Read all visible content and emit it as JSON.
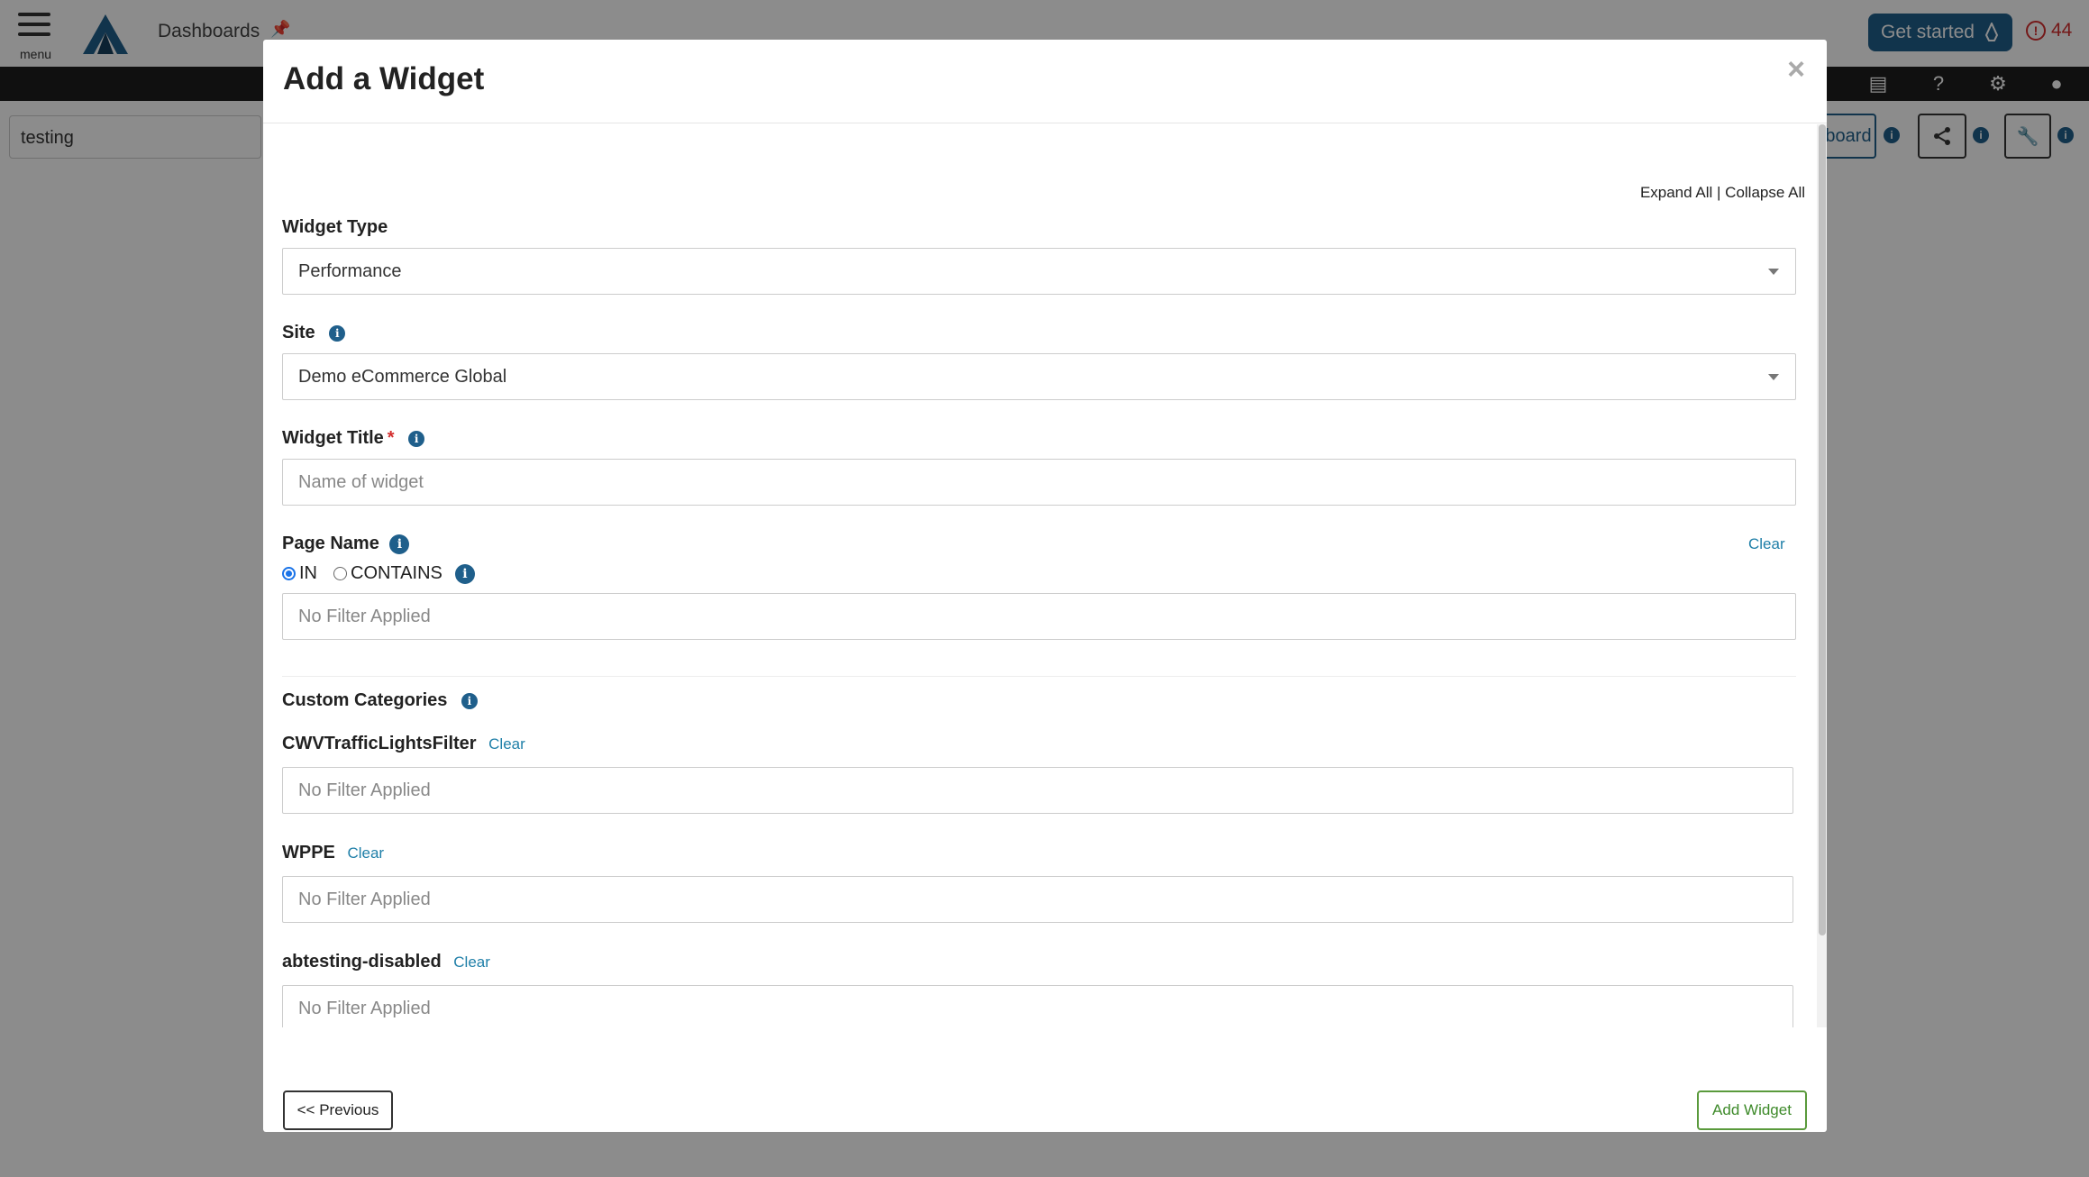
{
  "topbar": {
    "menu_label": "menu",
    "breadcrumb": "Dashboards",
    "get_started": "Get started",
    "alert_count": "44"
  },
  "subbar": {
    "dashboard_name": "testing",
    "board_button": "board"
  },
  "modal": {
    "title": "Add a Widget",
    "close": "×",
    "expand_all": "Expand All",
    "separator": "|",
    "collapse_all": "Collapse All",
    "widget_type": {
      "label": "Widget Type",
      "value": "Performance"
    },
    "site": {
      "label": "Site",
      "value": "Demo eCommerce Global"
    },
    "widget_title": {
      "label": "Widget Title",
      "required_mark": "*",
      "placeholder": "Name of widget"
    },
    "page_name": {
      "label": "Page Name",
      "clear": "Clear",
      "radio_in": "IN",
      "radio_contains": "CONTAINS",
      "selected": "IN",
      "placeholder": "No Filter Applied"
    },
    "custom_categories": {
      "label": "Custom Categories",
      "items": [
        {
          "name": "CWVTrafficLightsFilter",
          "clear": "Clear",
          "placeholder": "No Filter Applied"
        },
        {
          "name": "WPPE",
          "clear": "Clear",
          "placeholder": "No Filter Applied"
        },
        {
          "name": "abtesting-disabled",
          "clear": "Clear",
          "placeholder": "No Filter Applied"
        }
      ]
    },
    "footer": {
      "previous": "<< Previous",
      "add_widget": "Add Widget"
    }
  },
  "colors": {
    "accent": "#1f5f8b",
    "link": "#1f7fa8",
    "success": "#3e8a2a",
    "alert": "#d32f2f"
  }
}
